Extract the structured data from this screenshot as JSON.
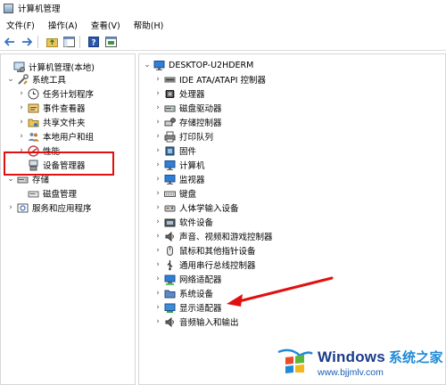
{
  "window": {
    "title": "计算机管理"
  },
  "menu": [
    "文件(F)",
    "操作(A)",
    "查看(V)",
    "帮助(H)"
  ],
  "left_tree": [
    {
      "label": "计算机管理(本地)",
      "chev": "",
      "icon": "computer-manage-icon",
      "indent": 0
    },
    {
      "label": "系统工具",
      "chev": "v",
      "icon": "tools-icon",
      "indent": 1
    },
    {
      "label": "任务计划程序",
      "chev": ">",
      "icon": "clock-icon",
      "indent": 2
    },
    {
      "label": "事件查看器",
      "chev": ">",
      "icon": "event-viewer-icon",
      "indent": 2
    },
    {
      "label": "共享文件夹",
      "chev": ">",
      "icon": "shared-folder-icon",
      "indent": 2
    },
    {
      "label": "本地用户和组",
      "chev": ">",
      "icon": "users-icon",
      "indent": 2
    },
    {
      "label": "性能",
      "chev": ">",
      "icon": "performance-icon",
      "indent": 2
    },
    {
      "label": "设备管理器",
      "chev": "",
      "icon": "device-manager-icon",
      "indent": 2
    },
    {
      "label": "存储",
      "chev": "v",
      "icon": "storage-icon",
      "indent": 1
    },
    {
      "label": "磁盘管理",
      "chev": "",
      "icon": "disk-icon",
      "indent": 2
    },
    {
      "label": "服务和应用程序",
      "chev": ">",
      "icon": "services-icon",
      "indent": 1
    }
  ],
  "device_tree": {
    "root": "DESKTOP-U2HDERM",
    "items": [
      {
        "label": "IDE ATA/ATAPI 控制器",
        "icon": "ide-icon"
      },
      {
        "label": "处理器",
        "icon": "processor-icon"
      },
      {
        "label": "磁盘驱动器",
        "icon": "disk-drive-icon"
      },
      {
        "label": "存储控制器",
        "icon": "storage-controller-icon"
      },
      {
        "label": "打印队列",
        "icon": "printer-icon"
      },
      {
        "label": "固件",
        "icon": "firmware-icon"
      },
      {
        "label": "计算机",
        "icon": "monitor-icon"
      },
      {
        "label": "监视器",
        "icon": "monitor-icon"
      },
      {
        "label": "键盘",
        "icon": "keyboard-icon"
      },
      {
        "label": "人体学输入设备",
        "icon": "hid-icon"
      },
      {
        "label": "软件设备",
        "icon": "software-device-icon"
      },
      {
        "label": "声音、视频和游戏控制器",
        "icon": "speaker-icon"
      },
      {
        "label": "鼠标和其他指针设备",
        "icon": "mouse-icon"
      },
      {
        "label": "通用串行总线控制器",
        "icon": "usb-icon"
      },
      {
        "label": "网络适配器",
        "icon": "network-icon"
      },
      {
        "label": "系统设备",
        "icon": "system-device-icon"
      },
      {
        "label": "显示适配器",
        "icon": "display-adapter-icon"
      },
      {
        "label": "音频输入和输出",
        "icon": "speaker-icon"
      }
    ]
  },
  "watermark": {
    "brand": "Windows",
    "brand_cn": "系统之家",
    "url": "www.bjjmlv.com"
  },
  "colors": {
    "highlight": "#e01010",
    "brand_blue": "#1a3a8c"
  }
}
